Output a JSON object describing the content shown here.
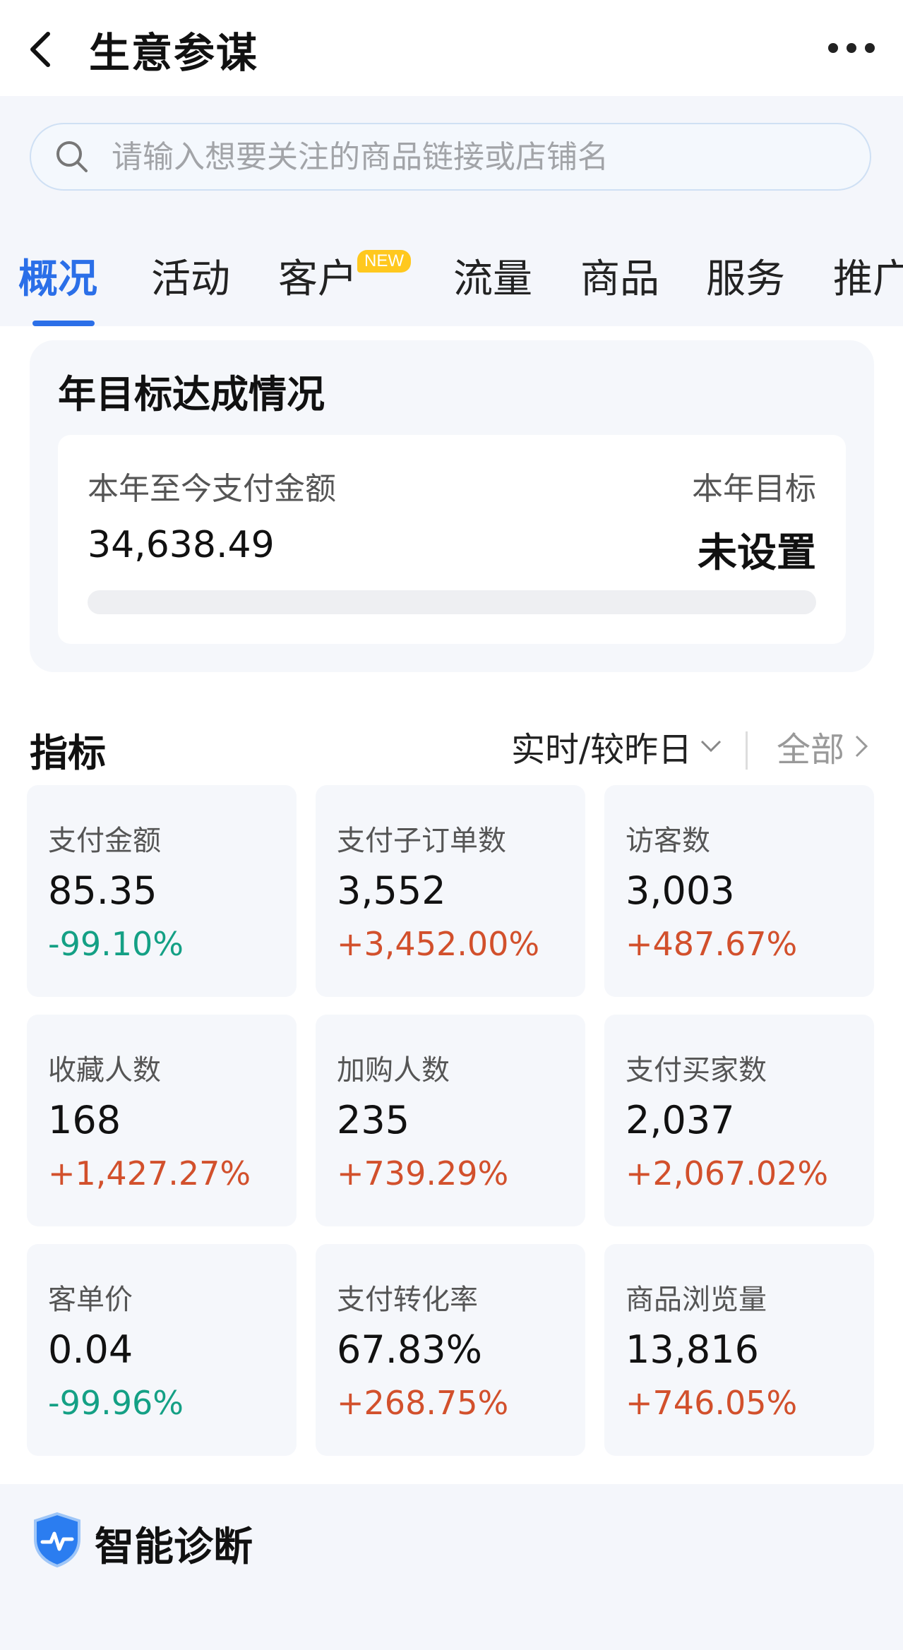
{
  "header": {
    "title": "生意参谋"
  },
  "search": {
    "placeholder": "请输入想要关注的商品链接或店铺名"
  },
  "tabs": [
    {
      "label": "概况",
      "active": true
    },
    {
      "label": "活动"
    },
    {
      "label": "客户",
      "badge": "NEW"
    },
    {
      "label": "流量"
    },
    {
      "label": "商品"
    },
    {
      "label": "服务"
    },
    {
      "label": "推广"
    }
  ],
  "goal": {
    "title": "年目标达成情况",
    "ytd_label": "本年至今支付金额",
    "ytd_value": "34,638.49",
    "target_label": "本年目标",
    "target_value": "未设置",
    "progress": 0
  },
  "metrics": {
    "title": "指标",
    "period": "实时/较昨日",
    "all_label": "全部",
    "items": [
      {
        "label": "支付金额",
        "value": "85.35",
        "change": "-99.10%",
        "trend": "down"
      },
      {
        "label": "支付子订单数",
        "value": "3,552",
        "change": "+3,452.00%",
        "trend": "up"
      },
      {
        "label": "访客数",
        "value": "3,003",
        "change": "+487.67%",
        "trend": "up"
      },
      {
        "label": "收藏人数",
        "value": "168",
        "change": "+1,427.27%",
        "trend": "up"
      },
      {
        "label": "加购人数",
        "value": "235",
        "change": "+739.29%",
        "trend": "up"
      },
      {
        "label": "支付买家数",
        "value": "2,037",
        "change": "+2,067.02%",
        "trend": "up"
      },
      {
        "label": "客单价",
        "value": "0.04",
        "change": "-99.96%",
        "trend": "down"
      },
      {
        "label": "支付转化率",
        "value": "67.83%",
        "change": "+268.75%",
        "trend": "up"
      },
      {
        "label": "商品浏览量",
        "value": "13,816",
        "change": "+746.05%",
        "trend": "up"
      }
    ]
  },
  "diagnosis": {
    "title": "智能诊断"
  },
  "colors": {
    "accent": "#2b6fe8",
    "up": "#d2502c",
    "down": "#14a085",
    "badge": "#ffc81e"
  }
}
